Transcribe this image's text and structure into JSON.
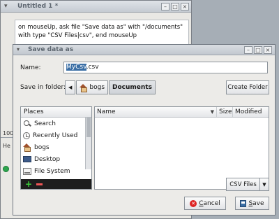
{
  "background_window": {
    "title": "Untitled 1 *",
    "script_text": "on mouseUp,    ask file \"Save data as\" with \"/documents\" with type \"CSV Files|csv\", end mouseUp",
    "left_fragments": {
      "a": "100",
      "b": "He"
    }
  },
  "dialog": {
    "title": "Save data as",
    "name_label": "Name:",
    "name_value_selected": "MyCsv",
    "name_value_rest": ".csv",
    "save_in_label": "Save in folder:",
    "path_back": "◀",
    "path_items": [
      "bogs",
      "Documents"
    ],
    "create_folder": "Create Folder",
    "places": {
      "header": "Places",
      "items": [
        {
          "label": "Search",
          "icon": "search-icon"
        },
        {
          "label": "Recently Used",
          "icon": "clock-icon"
        },
        {
          "label": "bogs",
          "icon": "home-icon"
        },
        {
          "label": "Desktop",
          "icon": "desktop-icon"
        },
        {
          "label": "File System",
          "icon": "drive-icon"
        }
      ],
      "add": "+",
      "remove": "−"
    },
    "files": {
      "columns": [
        "Name",
        "Size",
        "Modified"
      ]
    },
    "filter": "CSV Files",
    "cancel_mnemonic": "C",
    "cancel_rest": "ancel",
    "save_mnemonic": "S",
    "save_rest": "ave"
  },
  "colors": {
    "selection": "#3a6ea5",
    "places_toolbar": "#1e1e1e"
  }
}
